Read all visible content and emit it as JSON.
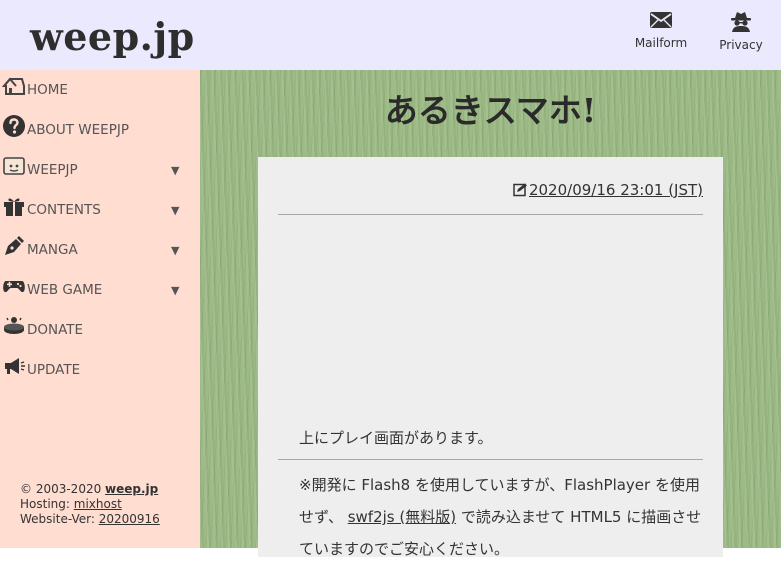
{
  "header": {
    "logo": "weep.jp",
    "mailform_label": "Mailform",
    "privacy_label": "Privacy"
  },
  "sidebar": {
    "items": [
      {
        "label": "HOME",
        "icon": "house-icon",
        "has_submenu": false
      },
      {
        "label": "ABOUT WEEPJP",
        "icon": "question-circle-icon",
        "has_submenu": false
      },
      {
        "label": "WEEPJP",
        "icon": "face-icon",
        "has_submenu": true
      },
      {
        "label": "CONTENTS",
        "icon": "gift-icon",
        "has_submenu": true
      },
      {
        "label": "MANGA",
        "icon": "pen-nib-icon",
        "has_submenu": true
      },
      {
        "label": "WEB GAME",
        "icon": "gamepad-icon",
        "has_submenu": true
      },
      {
        "label": "DONATE",
        "icon": "donate-icon",
        "has_submenu": false
      },
      {
        "label": "UPDATE",
        "icon": "megaphone-icon",
        "has_submenu": false
      }
    ],
    "arrow": "▼",
    "footer": {
      "copyright_prefix": "© 2003-2020 ",
      "copyright_link": "weep.jp",
      "hosting_prefix": "Hosting: ",
      "hosting_link": "mixhost",
      "version_prefix": "Website-Ver: ",
      "version_link": "20200916"
    }
  },
  "main": {
    "title": "あるきスマホ!",
    "date": "2020/09/16 23:01 (JST)",
    "play_note": "上にプレイ画面があります。",
    "body_before_link": "※開発に Flash8 を使用していますが、FlashPlayer を使用せず、 ",
    "body_link": "swf2js (無料版)",
    "body_after_link": " で読み込ませて HTML5 に描画させていますのでご安心ください。"
  },
  "colors": {
    "header_bg": "#ebe9fd",
    "sidebar_bg": "#ffddd0",
    "grass_bg": "#9dbb86",
    "card_bg": "#eeeeee"
  }
}
